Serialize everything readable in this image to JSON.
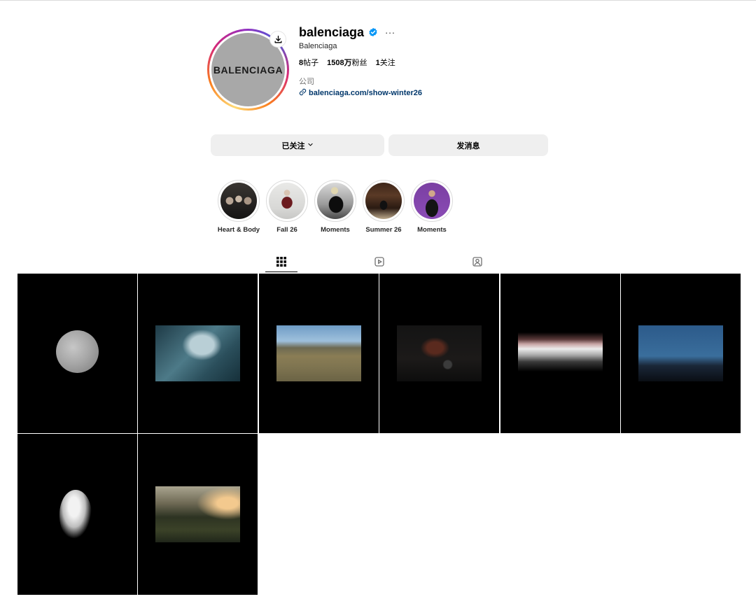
{
  "profile": {
    "username": "balenciaga",
    "full_name": "Balenciaga",
    "avatar_text": "BALENCIAGA",
    "more_label": "···",
    "stats": {
      "posts_count": "8",
      "posts_label": "帖子",
      "followers_count": "1508万",
      "followers_label": "粉丝",
      "following_count": "1",
      "following_label": "关注"
    },
    "category": "公司",
    "link": "balenciaga.com/show-winter26"
  },
  "actions": {
    "following_label": "已关注",
    "message_label": "发消息"
  },
  "highlights": [
    {
      "label": "Heart & Body"
    },
    {
      "label": "Fall 26"
    },
    {
      "label": "Moments"
    },
    {
      "label": "Summer 26"
    },
    {
      "label": "Moments"
    }
  ],
  "tabs": [
    {
      "icon": "grid-icon",
      "active": true
    },
    {
      "icon": "reels-icon",
      "active": false
    },
    {
      "icon": "tagged-icon",
      "active": false
    }
  ],
  "posts": [
    {
      "subject": "moon"
    },
    {
      "subject": "blue-figure"
    },
    {
      "subject": "desert-road"
    },
    {
      "subject": "dark-interior"
    },
    {
      "subject": "car-motion-blur"
    },
    {
      "subject": "windmill-dusk"
    },
    {
      "subject": "white-bird"
    },
    {
      "subject": "hills-sunset"
    }
  ],
  "colors": {
    "link": "#00376b",
    "verified": "#0095f6",
    "button_bg": "#efefef",
    "muted_text": "#737373"
  }
}
